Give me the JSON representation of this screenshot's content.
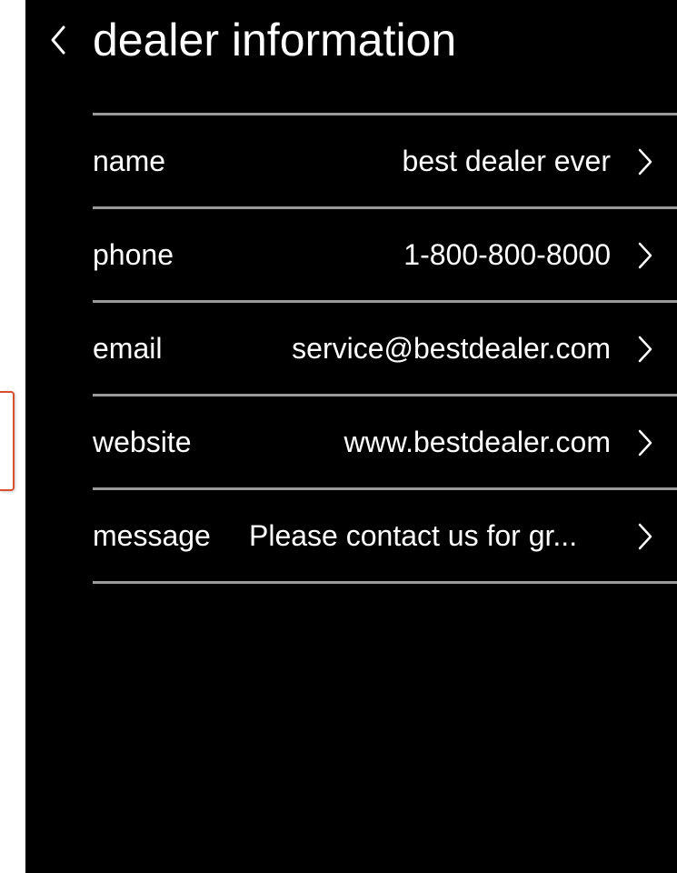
{
  "header": {
    "title": "dealer information",
    "back_icon": "chevron-left-icon"
  },
  "rows": [
    {
      "label": "name",
      "value": "best dealer ever",
      "icon": "chevron-right-icon"
    },
    {
      "label": "phone",
      "value": "1-800-800-8000",
      "icon": "chevron-right-icon"
    },
    {
      "label": "email",
      "value": "service@bestdealer.com",
      "icon": "chevron-right-icon"
    },
    {
      "label": "website",
      "value": "www.bestdealer.com",
      "icon": "chevron-right-icon"
    },
    {
      "label": "message",
      "value": "Please contact us for gr...",
      "icon": "chevron-right-icon"
    }
  ],
  "colors": {
    "background": "#000000",
    "text": "#ffffff",
    "divider": "#9a9a9a",
    "side_tab_border": "#d9502e"
  }
}
